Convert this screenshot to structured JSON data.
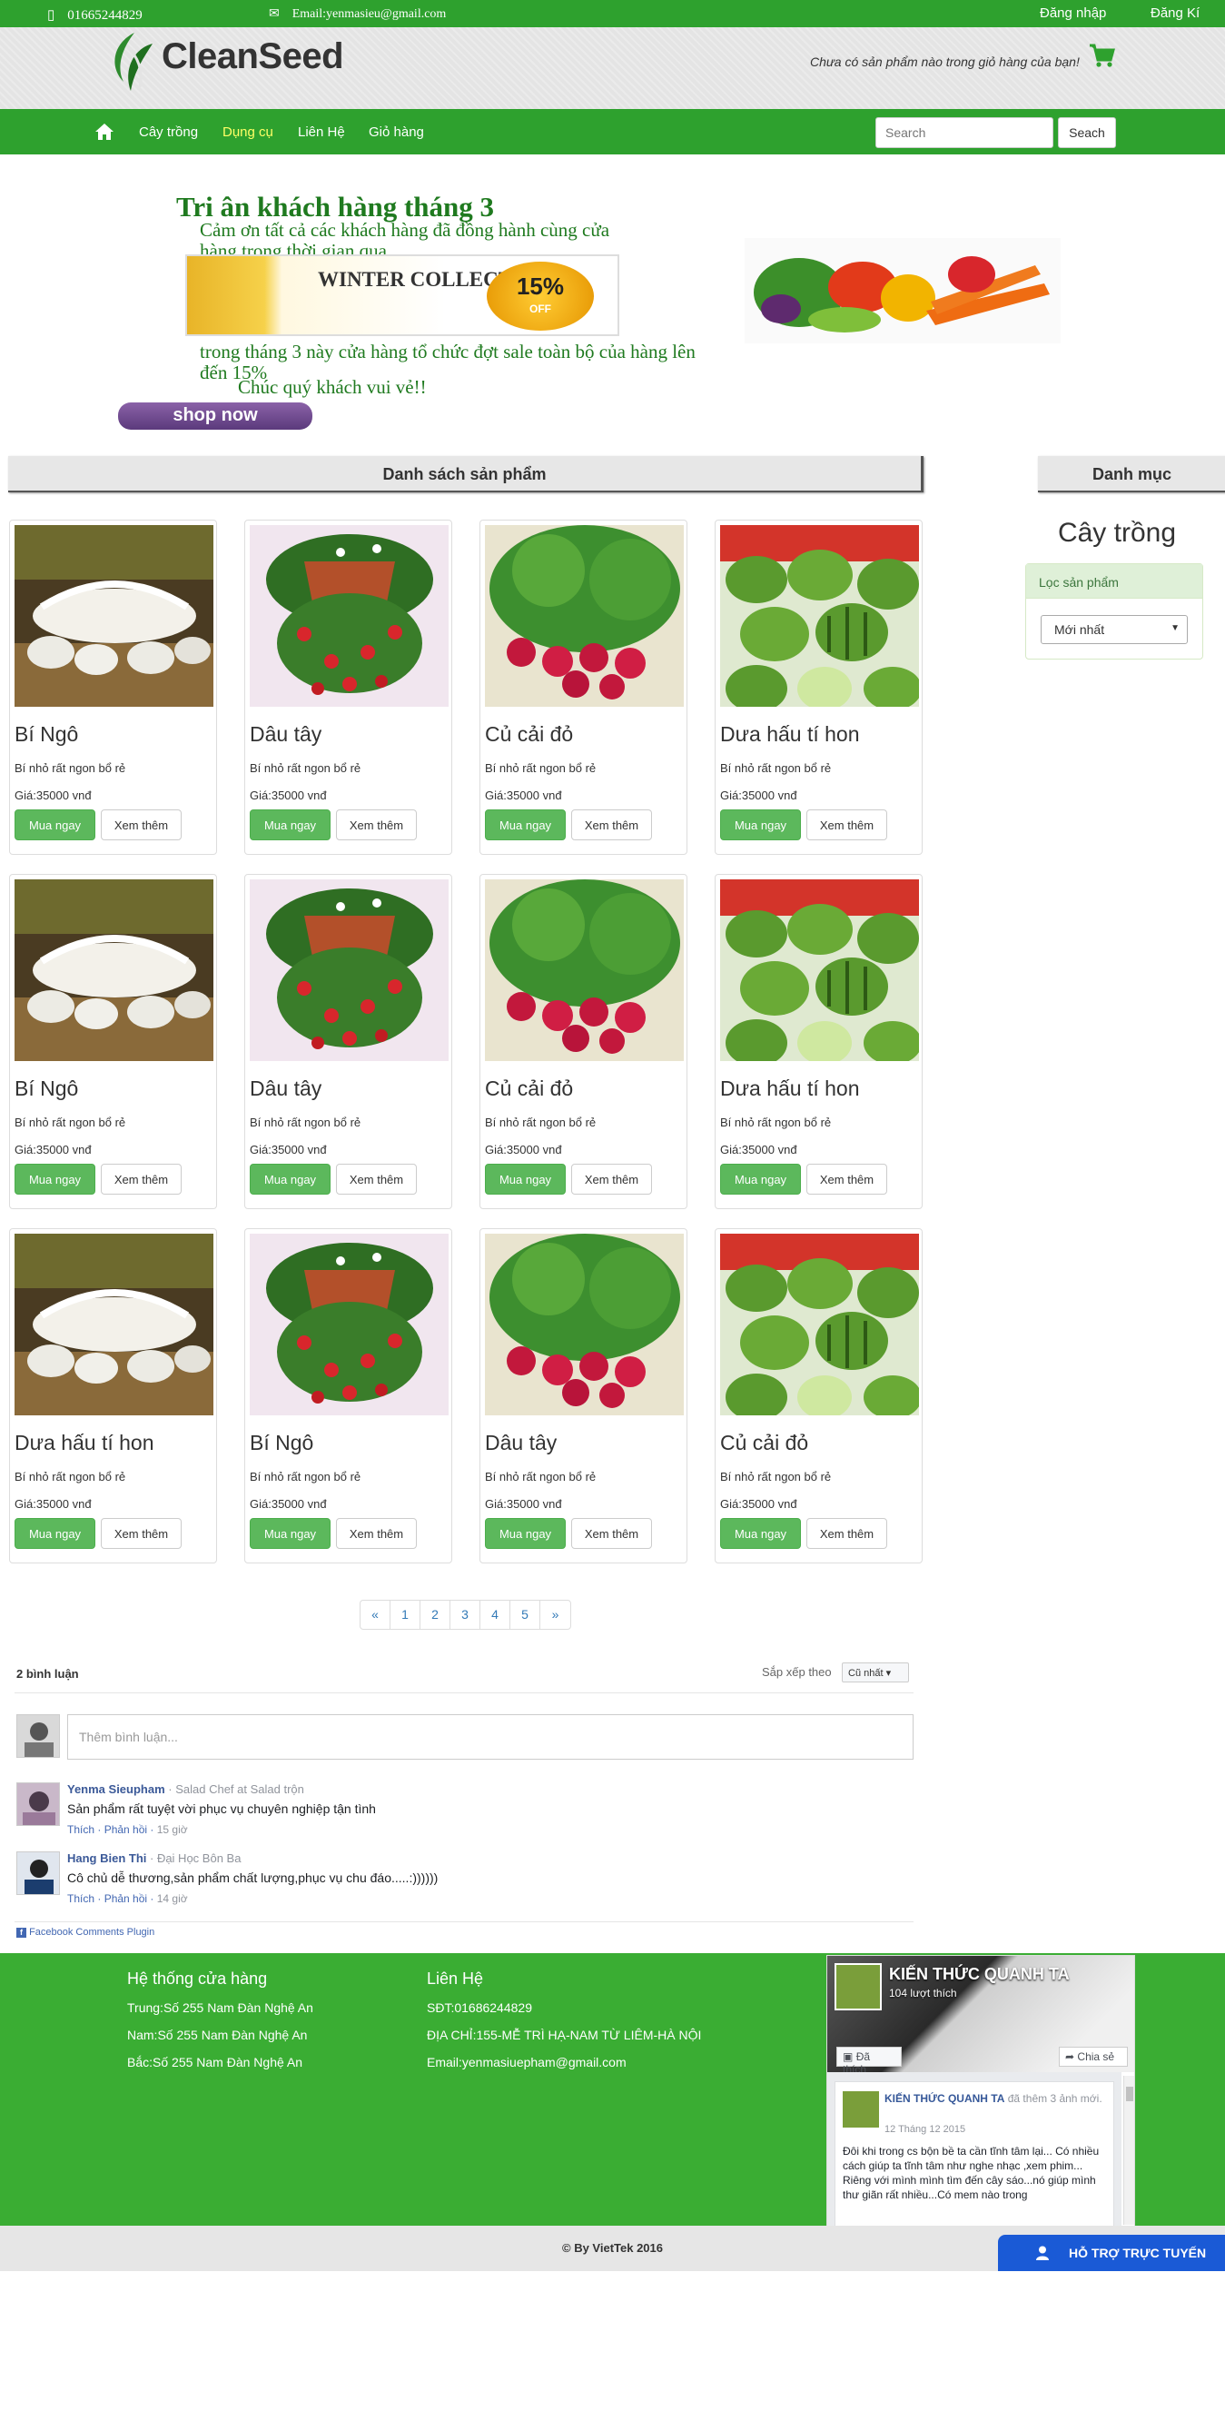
{
  "topbar": {
    "phone": "01665244829",
    "email": "Email:yenmasieu@gmail.com",
    "login": "Đăng nhập",
    "register": "Đăng Kí"
  },
  "brand": {
    "logo_text": "CleanSeed",
    "cart_message": "Chưa có sản phẩm nào trong giỏ hàng của bạn!"
  },
  "nav": {
    "items": [
      "Cây trồng",
      "Dụng cụ",
      "Liên Hệ",
      "Giỏ hàng"
    ],
    "active_index": 1,
    "search_placeholder": "Search",
    "search_button": "Seach"
  },
  "banner": {
    "title": "Tri ân khách hàng tháng 3",
    "line1": "Cảm ơn tất cả các khách hàng đã đồng hành cùng cửa hàng trong thời gian qua",
    "winter_text": "WINTER COLLECTION",
    "badge_percent": "15%",
    "badge_off": "OFF",
    "line2": "trong tháng 3 này cửa hàng tổ chức đợt sale toàn bộ của hàng lên đến 15%",
    "line3": "Chúc quý khách vui vẻ!!",
    "shop_now": "shop now"
  },
  "products": {
    "header": "Danh sách sản phẩm",
    "buy_label": "Mua ngay",
    "more_label": "Xem thêm",
    "items": [
      {
        "name": "Bí Ngô",
        "desc": "Bí nhỏ rất ngon bổ rẻ",
        "price": "Giá:35000 vnđ",
        "image": "pumpkin"
      },
      {
        "name": "Dâu tây",
        "desc": "Bí nhỏ rất ngon bổ rẻ",
        "price": "Giá:35000 vnđ",
        "image": "strawberry"
      },
      {
        "name": "Củ cải đỏ",
        "desc": "Bí nhỏ rất ngon bổ rẻ",
        "price": "Giá:35000 vnđ",
        "image": "radish"
      },
      {
        "name": "Dưa hấu tí hon",
        "desc": "Bí nhỏ rất ngon bổ rẻ",
        "price": "Giá:35000 vnđ",
        "image": "melon"
      },
      {
        "name": "Bí Ngô",
        "desc": "Bí nhỏ rất ngon bổ rẻ",
        "price": "Giá:35000 vnđ",
        "image": "pumpkin"
      },
      {
        "name": "Dâu tây",
        "desc": "Bí nhỏ rất ngon bổ rẻ",
        "price": "Giá:35000 vnđ",
        "image": "strawberry"
      },
      {
        "name": "Củ cải đỏ",
        "desc": "Bí nhỏ rất ngon bổ rẻ",
        "price": "Giá:35000 vnđ",
        "image": "radish"
      },
      {
        "name": "Dưa hấu tí hon",
        "desc": "Bí nhỏ rất ngon bổ rẻ",
        "price": "Giá:35000 vnđ",
        "image": "melon"
      },
      {
        "name": "Dưa hấu tí hon",
        "desc": "Bí nhỏ rất ngon bổ rẻ",
        "price": "Giá:35000 vnđ",
        "image": "pumpkin"
      },
      {
        "name": "Bí Ngô",
        "desc": "Bí nhỏ rất ngon bổ rẻ",
        "price": "Giá:35000 vnđ",
        "image": "strawberry"
      },
      {
        "name": "Dâu tây",
        "desc": "Bí nhỏ rất ngon bổ rẻ",
        "price": "Giá:35000 vnđ",
        "image": "radish"
      },
      {
        "name": "Củ cải đỏ",
        "desc": "Bí nhỏ rất ngon bổ rẻ",
        "price": "Giá:35000 vnđ",
        "image": "melon"
      }
    ]
  },
  "pagination": [
    "«",
    "1",
    "2",
    "3",
    "4",
    "5",
    "»"
  ],
  "sidebar": {
    "header": "Danh mục",
    "title": "Cây trồng",
    "filter_label": "Lọc sản phẩm",
    "filter_selected": "Mới nhất"
  },
  "comments": {
    "count": "2 bình luận",
    "sort_label": "Sắp xếp theo",
    "sort_selected": "Cũ nhất",
    "input_placeholder": "Thêm bình luận...",
    "items": [
      {
        "name": "Yenma Sieupham",
        "work": " · Salad Chef at Salad trộn",
        "text": "Sản phẩm rất tuyệt vời phục vụ chuyên nghiệp tận tình",
        "like": "Thích",
        "reply": "Phản hồi",
        "time": "15 giờ"
      },
      {
        "name": "Hang Bien Thi",
        "work": " · Đại Học Bôn Ba",
        "text": "Cô chủ dễ thương,sản phẩm chất lượng,phục vụ chu đáo.....:))))))",
        "like": "Thích",
        "reply": "Phản hồi",
        "time": "14 giờ"
      }
    ],
    "plugin": "Facebook Comments Plugin"
  },
  "footer": {
    "stores_title": "Hệ thống cửa hàng",
    "stores": [
      "Trung:Số 255 Nam Đàn Nghệ An",
      "Nam:Số 255 Nam Đàn Nghệ An",
      "Bắc:Số 255 Nam Đàn Nghệ An"
    ],
    "contact_title": "Liên Hệ",
    "contact": [
      "SĐT:01686244829",
      "ĐỊA CHỈ:155-MỄ TRÌ HẠ-NAM TỪ LIÊM-HÀ NỘI",
      "Email:yenmasiuepham@gmail.com"
    ],
    "fbpage": {
      "name": "KIẾN THỨC QUANH TA",
      "likes": "104 lượt thích",
      "liked": "Đã thích",
      "share": "Chia sẻ",
      "post_author": "KIẾN THỨC QUANH TA",
      "post_action": "đã thêm 3 ảnh mới.",
      "post_date": "12 Tháng 12 2015",
      "post_text": "Đôi khi trong cs bộn bề ta cần tĩnh tâm lại... Có nhiều cách giúp ta tĩnh tâm như nghe nhạc ,xem phim... Riêng với mình mình tìm đến cây sáo...nó giúp mình thư giãn rất nhiều...Có mem nào trong"
    },
    "copyright": "© By VietTek 2016",
    "support": "HỖ TRỢ TRỰC TUYẾN"
  },
  "colors": {
    "primary_green": "#2ea12e",
    "footer_green": "#3aad33",
    "button_green": "#5cb85c",
    "support_blue": "#1a5ad6"
  }
}
